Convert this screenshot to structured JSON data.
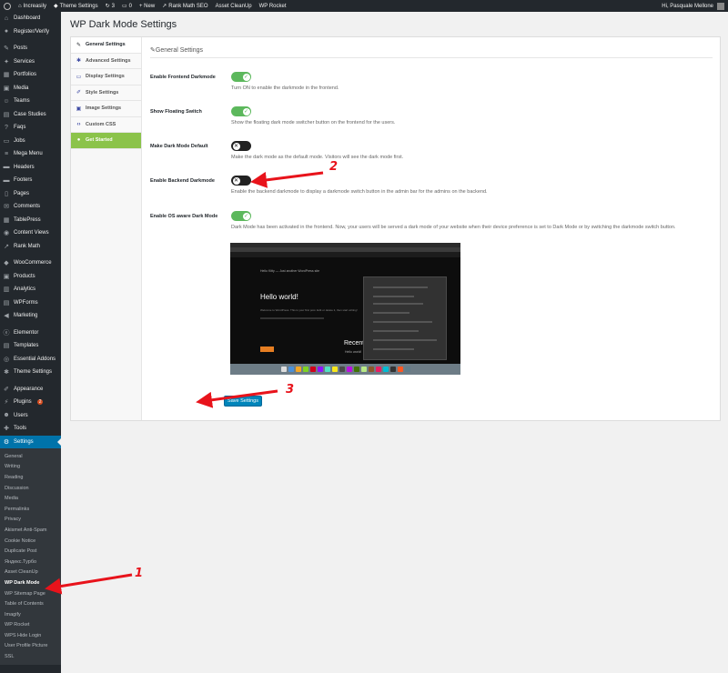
{
  "adminbar": {
    "site_name": "Increasily",
    "theme_settings": "Theme Settings",
    "updates": "3",
    "comments": "0",
    "new": "+ New",
    "rank_math": "Rank Math SEO",
    "asset_cleanup": "Asset CleanUp",
    "wp_rocket": "WP Rocket",
    "greeting": "Hi, Pasquale Mellone"
  },
  "sidebar": {
    "items": [
      {
        "icon": "⌂",
        "label": "Dashboard"
      },
      {
        "icon": "●",
        "label": "Register/Verify"
      },
      {
        "icon": "✎",
        "label": "Posts"
      },
      {
        "icon": "✦",
        "label": "Services"
      },
      {
        "icon": "▦",
        "label": "Portfolios"
      },
      {
        "icon": "▣",
        "label": "Media"
      },
      {
        "icon": "☺",
        "label": "Teams"
      },
      {
        "icon": "▤",
        "label": "Case Studies"
      },
      {
        "icon": "?",
        "label": "Faqs"
      },
      {
        "icon": "▭",
        "label": "Jobs"
      },
      {
        "icon": "≡",
        "label": "Mega Menu"
      },
      {
        "icon": "▬",
        "label": "Headers"
      },
      {
        "icon": "▬",
        "label": "Footers"
      },
      {
        "icon": "▯",
        "label": "Pages"
      },
      {
        "icon": "✉",
        "label": "Comments"
      },
      {
        "icon": "▦",
        "label": "TablePress"
      },
      {
        "icon": "◉",
        "label": "Content Views"
      },
      {
        "icon": "↗",
        "label": "Rank Math"
      },
      {
        "icon": "◆",
        "label": "WooCommerce"
      },
      {
        "icon": "▣",
        "label": "Products"
      },
      {
        "icon": "▥",
        "label": "Analytics"
      },
      {
        "icon": "▤",
        "label": "WPForms"
      },
      {
        "icon": "◀",
        "label": "Marketing"
      },
      {
        "icon": "ⓔ",
        "label": "Elementor"
      },
      {
        "icon": "▤",
        "label": "Templates"
      },
      {
        "icon": "◎",
        "label": "Essential Addons"
      },
      {
        "icon": "✱",
        "label": "Theme Settings"
      },
      {
        "icon": "✐",
        "label": "Appearance"
      },
      {
        "icon": "⚡",
        "label": "Plugins",
        "badge": "2"
      },
      {
        "icon": "☻",
        "label": "Users"
      },
      {
        "icon": "✚",
        "label": "Tools"
      },
      {
        "icon": "⚙",
        "label": "Settings"
      }
    ],
    "submenu": [
      "General",
      "Writing",
      "Reading",
      "Discussion",
      "Media",
      "Permalinks",
      "Privacy",
      "Akismet Anti-Spam",
      "Cookie Notice",
      "Duplicate Post",
      "Яндекс.Турбо",
      "Asset CleanUp",
      "WP Dark Mode",
      "WP Sitemap Page",
      "Table of Contents",
      "Imagify",
      "WP Rocket",
      "WPS Hide Login",
      "User Profile Picture",
      "SSL"
    ]
  },
  "page": {
    "title": "WP Dark Mode Settings",
    "section_title": "General Settings",
    "tabs": [
      {
        "icon": "✎",
        "label": "General Settings"
      },
      {
        "icon": "✱",
        "label": "Advanced Settings"
      },
      {
        "icon": "▭",
        "label": "Display Settings"
      },
      {
        "icon": "✐",
        "label": "Style Settings"
      },
      {
        "icon": "▣",
        "label": "Image Settings"
      },
      {
        "icon": "‹›",
        "label": "Custom CSS"
      },
      {
        "icon": "●",
        "label": "Get Started"
      }
    ],
    "rows": [
      {
        "label": "Enable Frontend Darkmode",
        "state": "on",
        "desc": "Turn ON to enable the darkmode in the frontend."
      },
      {
        "label": "Show Floating Switch",
        "state": "on",
        "desc": "Show the floating dark mode switcher button on the frontend for the users."
      },
      {
        "label": "Make Dark Mode Default",
        "state": "off",
        "desc": "Make the dark mode as the default mode. Visitors will see the dark mode first."
      },
      {
        "label": "Enable Backend Darkmode",
        "state": "off",
        "desc": "Enable the backend darkmode to display a darkmode switch button in the admin bar for the admins on the backend."
      },
      {
        "label": "Enable OS aware Dark Mode",
        "state": "on",
        "desc": "Dark Mode has been activated in the frontend. Now, your users will be served a dark mode of your website when their device preference is set to Dark Mode or by switching the darkmode switch button."
      }
    ],
    "save_label": "Save Settings"
  },
  "preview": {
    "site": "Hello Kitty  —  Just another WordPress site",
    "hello": "Hello world!",
    "text": "Welcome to WordPress. This is your first post. Edit or delete it, then start writing!",
    "recent": "Recent",
    "hello_small": "Hello world!"
  },
  "annotations": [
    "1",
    "2",
    "3"
  ],
  "colors": {
    "accent": "#0073aa",
    "toggle_on": "#5cb85c",
    "get_started": "#8bc34a",
    "annotation": "#e8131b"
  }
}
